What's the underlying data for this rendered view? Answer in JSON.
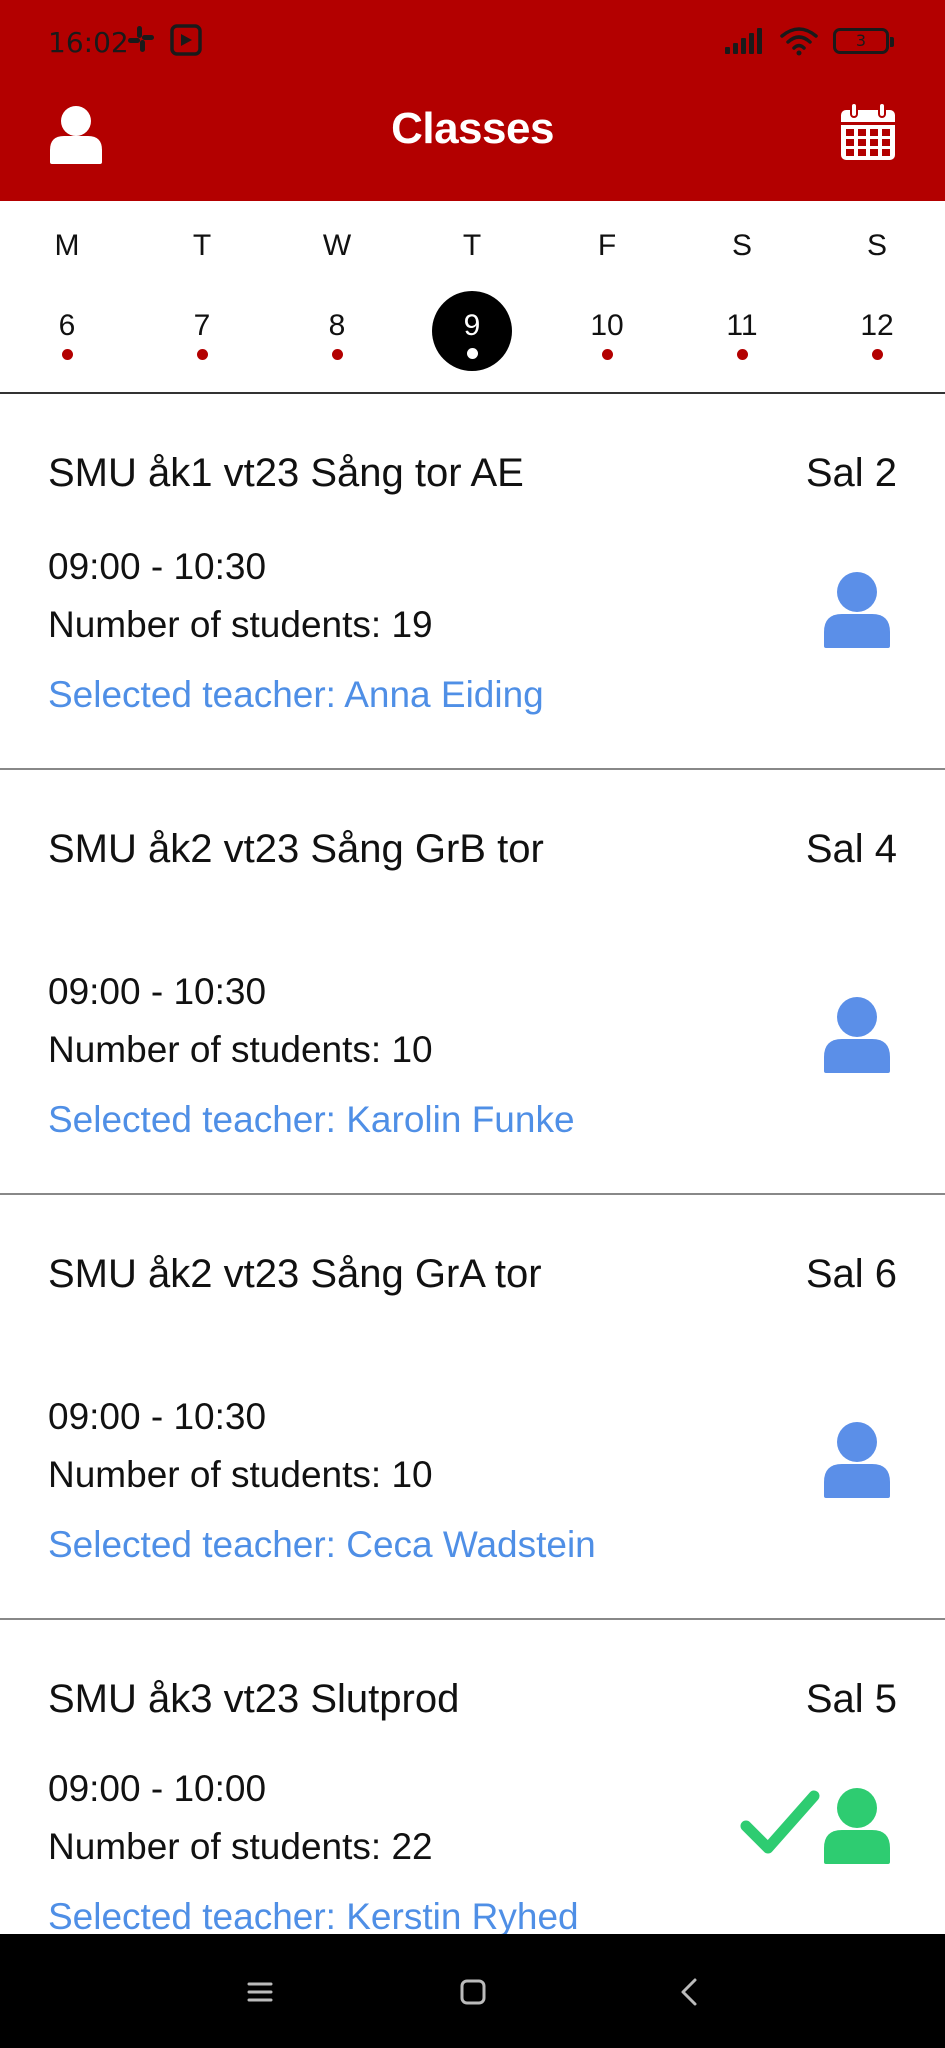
{
  "status": {
    "time": "16:02",
    "battery": "3"
  },
  "appbar": {
    "title": "Classes",
    "left_icon": "profile-icon",
    "right_icon": "calendar-icon"
  },
  "week": {
    "days": [
      {
        "letter": "M",
        "number": "6",
        "selected": false
      },
      {
        "letter": "T",
        "number": "7",
        "selected": false
      },
      {
        "letter": "W",
        "number": "8",
        "selected": false
      },
      {
        "letter": "T",
        "number": "9",
        "selected": true
      },
      {
        "letter": "F",
        "number": "10",
        "selected": false
      },
      {
        "letter": "S",
        "number": "11",
        "selected": false
      },
      {
        "letter": "S",
        "number": "12",
        "selected": false
      }
    ]
  },
  "classes": [
    {
      "title": "SMU åk1 vt23 Sång tor AE",
      "room": "Sal 2",
      "time": "09:00 - 10:30",
      "students": "Number of students: 19",
      "teacher": "Selected teacher: Anna Eiding",
      "status": "pending"
    },
    {
      "title": "SMU åk2 vt23 Sång GrB tor",
      "room": "Sal 4",
      "time": "09:00 - 10:30",
      "students": "Number of students: 10",
      "teacher": "Selected teacher: Karolin Funke",
      "status": "pending"
    },
    {
      "title": "SMU åk2 vt23 Sång GrA tor",
      "room": "Sal 6",
      "time": "09:00 - 10:30",
      "students": "Number of students: 10",
      "teacher": "Selected teacher: Ceca Wadstein",
      "status": "pending"
    },
    {
      "title": "SMU åk3 vt23 Slutprod",
      "room": "Sal 5",
      "time": "09:00 - 10:00",
      "students": "Number of students: 22",
      "teacher": "Selected teacher: Kerstin Ryhed",
      "status": "confirmed"
    }
  ],
  "colors": {
    "brand": "#b30000",
    "teacher_link": "#4f8fe6",
    "pending_icon": "#5b8fe8",
    "confirmed_icon": "#2ecc71"
  }
}
